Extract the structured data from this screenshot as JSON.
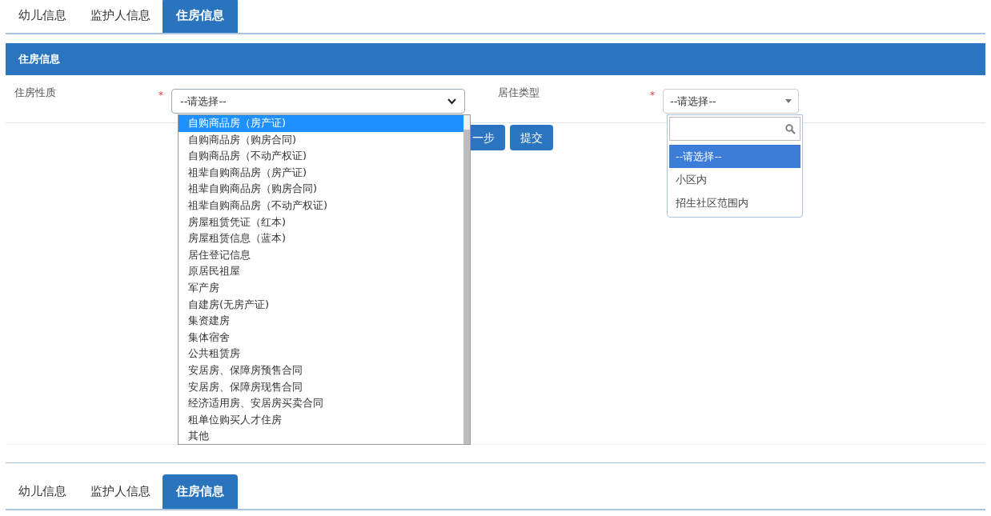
{
  "tabs": [
    {
      "label": "幼儿信息",
      "selected": false
    },
    {
      "label": "监护人信息",
      "selected": false
    },
    {
      "label": "住房信息",
      "selected": true
    }
  ],
  "section_title": "住房信息",
  "fields": [
    {
      "label": "住房性质",
      "required_mark": "*",
      "value": "--请选择--"
    },
    {
      "label": "居住类型",
      "required_mark": "*",
      "value": "--请选择--"
    }
  ],
  "housing_options": [
    {
      "label": "自购商品房（房产证)",
      "selected": true
    },
    {
      "label": "自购商品房（购房合同)",
      "selected": false
    },
    {
      "label": "自购商品房（不动产权证)",
      "selected": false
    },
    {
      "label": "祖辈自购商品房（房产证)",
      "selected": false
    },
    {
      "label": "祖辈自购商品房（购房合同)",
      "selected": false
    },
    {
      "label": "祖辈自购商品房（不动产权证)",
      "selected": false
    },
    {
      "label": "房屋租赁凭证（红本)",
      "selected": false
    },
    {
      "label": "房屋租赁信息（蓝本)",
      "selected": false
    },
    {
      "label": "居住登记信息",
      "selected": false
    },
    {
      "label": "原居民祖屋",
      "selected": false
    },
    {
      "label": "军产房",
      "selected": false
    },
    {
      "label": "自建房(无房产证)",
      "selected": false
    },
    {
      "label": "集资建房",
      "selected": false
    },
    {
      "label": "集体宿舍",
      "selected": false
    },
    {
      "label": "公共租赁房",
      "selected": false
    },
    {
      "label": "安居房、保障房预售合同",
      "selected": false
    },
    {
      "label": "安居房、保障房现售合同",
      "selected": false
    },
    {
      "label": "经济适用房、安居房买卖合同",
      "selected": false
    },
    {
      "label": "租单位购买人才住房",
      "selected": false
    },
    {
      "label": "其他",
      "selected": false
    }
  ],
  "residence_options": [
    {
      "label": "--请选择--",
      "selected": true
    },
    {
      "label": "小区内",
      "selected": false
    },
    {
      "label": "招生社区范围内",
      "selected": false
    }
  ],
  "buttons": [
    "一步",
    "提交"
  ],
  "bottom_tabs": [
    {
      "label": "幼儿信息",
      "selected": false
    },
    {
      "label": "监护人信息",
      "selected": false
    },
    {
      "label": "住房信息",
      "selected": true
    }
  ]
}
